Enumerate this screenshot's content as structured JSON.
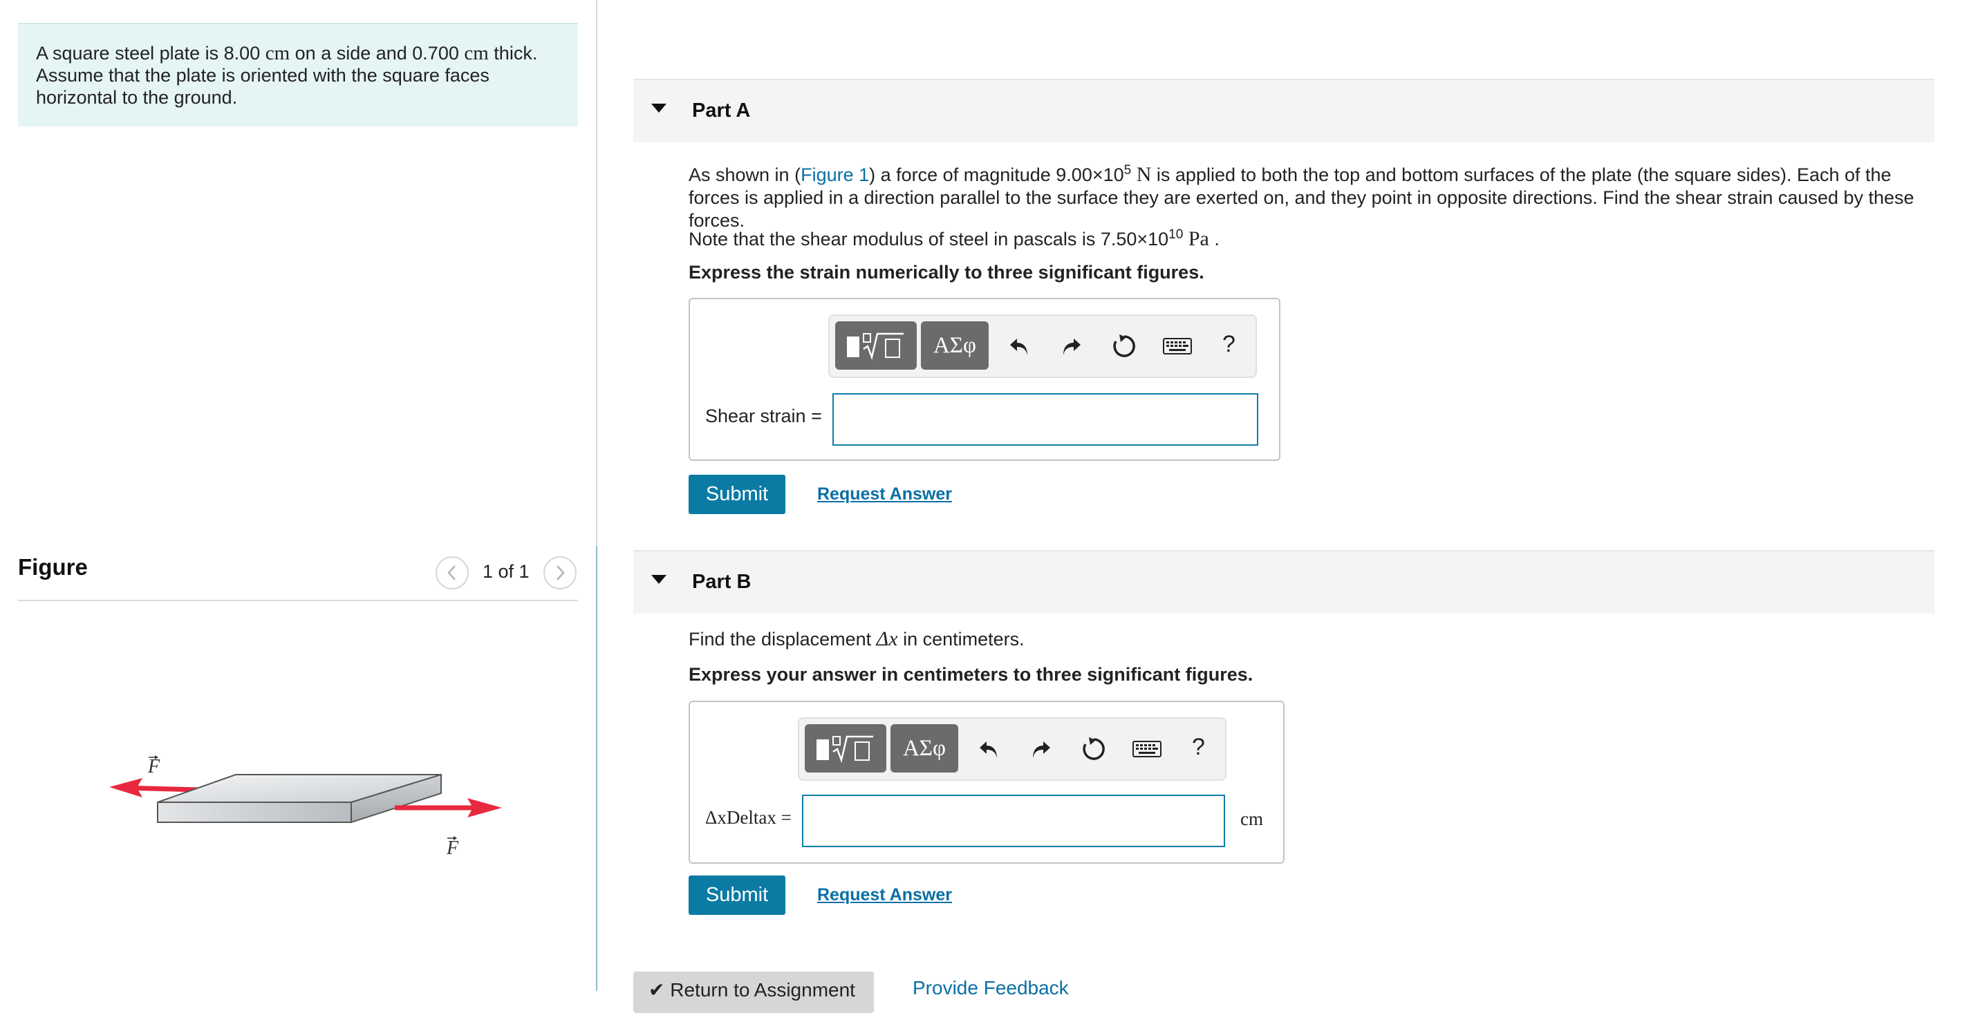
{
  "problem": {
    "text_1": "A square steel plate is 8.00 ",
    "unit_1": "cm",
    "text_2": " on a side and 0.700 ",
    "unit_2": "cm",
    "text_3": " thick. Assume that the plate is oriented with the square faces horizontal to the ground."
  },
  "figure": {
    "title": "Figure",
    "prev_icon": "chevron-left-icon",
    "next_icon": "chevron-right-icon",
    "count": "1 of 1",
    "force_label_top": "F",
    "force_label_bottom": "F",
    "arrow_color": "#e8283f"
  },
  "partA": {
    "label": "Part A",
    "q_1": "As shown in (",
    "figure_link": "Figure 1",
    "q_2": ") a force of magnitude 9.00×10",
    "q_exp": "5",
    "q_unit": "N",
    "q_3": " is applied to both the top and bottom surfaces of the plate (the square sides). Each of the forces is applied in a direction parallel to the surface they are exerted on, and they point in opposite directions. Find the shear strain caused by these forces.",
    "note_1": "Note that the shear modulus of steel in pascals is 7.50×10",
    "note_exp": "10",
    "note_unit": "Pa",
    "note_end": " .",
    "instruction": "Express the strain numerically to three significant figures.",
    "input_label": "Shear strain =",
    "input_value": "",
    "submit": "Submit",
    "request": "Request Answer"
  },
  "partB": {
    "label": "Part B",
    "q_1": "Find the displacement ",
    "q_symbol": "Δx",
    "q_2": " in centimeters.",
    "instruction": "Express your answer in centimeters to three significant figures.",
    "input_label": "ΔxDeltax =",
    "input_value": "",
    "unit": "cm",
    "submit": "Submit",
    "request": "Request Answer"
  },
  "toolbar": {
    "greek": "ΑΣφ",
    "help": "?",
    "icons": [
      "templates-icon",
      "greek-symbols-icon",
      "undo-icon",
      "redo-icon",
      "reset-icon",
      "keyboard-icon",
      "help-icon"
    ]
  },
  "footer": {
    "return": "Return to Assignment",
    "feedback": "Provide Feedback"
  }
}
